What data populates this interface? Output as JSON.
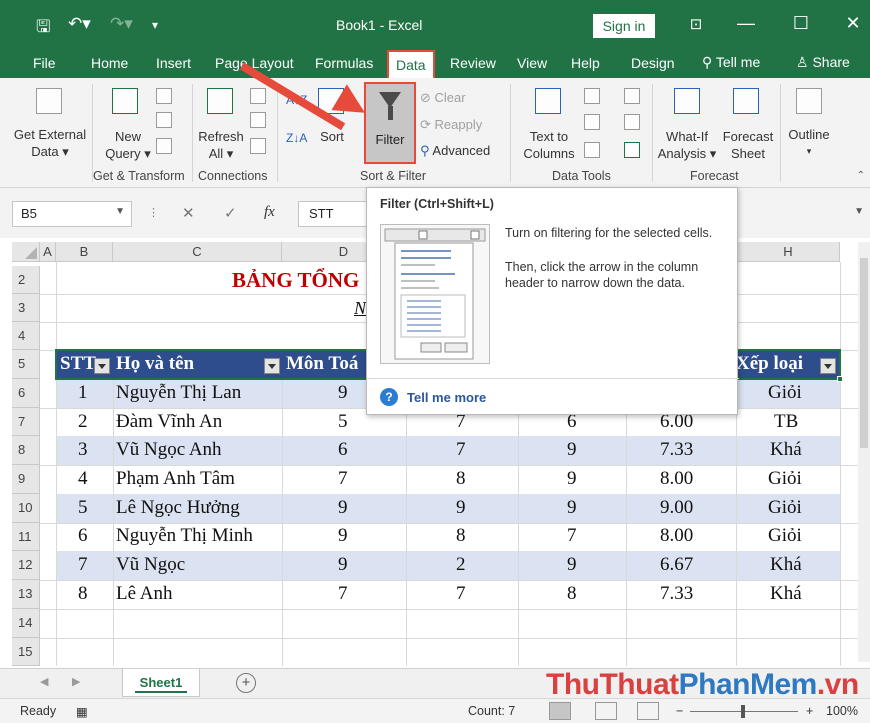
{
  "window": {
    "title": "Book1  -  Excel",
    "sign_in": "Sign in",
    "save_icon": "save-icon",
    "undo_icon": "undo-icon",
    "redo_icon": "redo-icon"
  },
  "tabs": [
    "File",
    "Home",
    "Insert",
    "Page Layout",
    "Formulas",
    "Data",
    "Review",
    "View",
    "Help",
    "Design"
  ],
  "active_tab": "Data",
  "tell_me": "Tell me",
  "share": "Share",
  "ribbon": {
    "get_external": [
      "Get External",
      "Data ▾"
    ],
    "new_query": [
      "New",
      "Query ▾"
    ],
    "refresh_all": [
      "Refresh",
      "All ▾"
    ],
    "sort": "Sort",
    "filter": "Filter",
    "clear": "Clear",
    "reapply": "Reapply",
    "advanced": "Advanced",
    "text_to_columns": [
      "Text to",
      "Columns"
    ],
    "what_if": [
      "What-If",
      "Analysis ▾"
    ],
    "forecast_sheet": [
      "Forecast",
      "Sheet"
    ],
    "outline": "Outline",
    "groups": {
      "get_transform": "Get & Transform",
      "connections": "Connections",
      "sort_filter": "Sort & Filter",
      "data_tools": "Data Tools",
      "forecast": "Forecast"
    }
  },
  "formula_bar": {
    "name_box": "B5",
    "cancel": "✕",
    "enter": "✓",
    "fx": "fx",
    "content": "STT"
  },
  "tooltip": {
    "title": "Filter (Ctrl+Shift+L)",
    "desc1": "Turn on filtering for the selected cells.",
    "desc2": "Then, click the arrow in the column header to narrow down the data.",
    "more": "Tell me more"
  },
  "sheet": {
    "columns": [
      "A",
      "B",
      "C",
      "D",
      "H"
    ],
    "rows": [
      "2",
      "3",
      "4",
      "5",
      "6",
      "7",
      "8",
      "9",
      "10",
      "11",
      "12",
      "13",
      "14",
      "15"
    ],
    "title": "BẢNG TỔNG",
    "subtitle": "N",
    "headers": {
      "stt": "STT",
      "name": "Họ và tên",
      "math": "Môn Toá",
      "rank": "Xếp loại"
    },
    "data": [
      {
        "stt": "1",
        "name": "Nguyễn Thị Lan",
        "d": "9",
        "e": "",
        "f": "",
        "g": "",
        "h": "Giỏi"
      },
      {
        "stt": "2",
        "name": "Đàm Vĩnh An",
        "d": "5",
        "e": "7",
        "f": "6",
        "g": "6.00",
        "h": "TB"
      },
      {
        "stt": "3",
        "name": "Vũ Ngọc Anh",
        "d": "6",
        "e": "7",
        "f": "9",
        "g": "7.33",
        "h": "Khá"
      },
      {
        "stt": "4",
        "name": "Phạm Anh Tâm",
        "d": "7",
        "e": "8",
        "f": "9",
        "g": "8.00",
        "h": "Giỏi"
      },
      {
        "stt": "5",
        "name": "Lê Ngọc Hưởng",
        "d": "9",
        "e": "9",
        "f": "9",
        "g": "9.00",
        "h": "Giỏi"
      },
      {
        "stt": "6",
        "name": "Nguyễn Thị Minh",
        "d": "9",
        "e": "8",
        "f": "7",
        "g": "8.00",
        "h": "Giỏi"
      },
      {
        "stt": "7",
        "name": "Vũ Ngọc",
        "d": "9",
        "e": "2",
        "f": "9",
        "g": "6.67",
        "h": "Khá"
      },
      {
        "stt": "8",
        "name": "Lê Anh",
        "d": "7",
        "e": "7",
        "f": "8",
        "g": "7.33",
        "h": "Khá"
      }
    ]
  },
  "sheet_tab": "Sheet1",
  "watermark": [
    "ThuThuat",
    "PhanMem",
    ".vn"
  ],
  "status": {
    "ready": "Ready",
    "count": "Count: 7",
    "zoom": "100%",
    "zoom_minus": "−",
    "zoom_plus": "+"
  },
  "colors": {
    "excel_green": "#217346",
    "header_blue": "#2e4d8c",
    "band_blue": "#dbe2f1",
    "highlight_red": "#e64a3b",
    "title_red": "#c00000"
  }
}
